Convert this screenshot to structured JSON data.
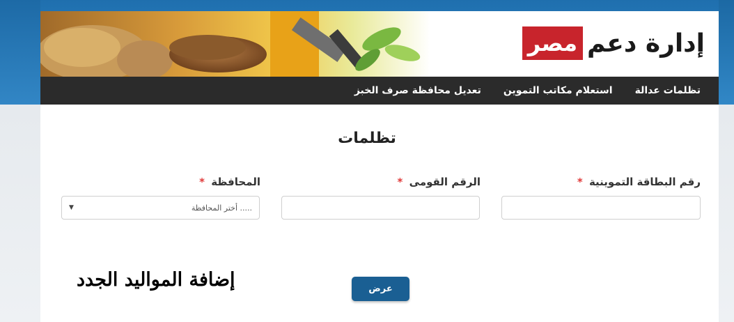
{
  "header": {
    "logo_text": "إدارة دعم",
    "logo_badge": "مصر"
  },
  "nav": {
    "items": [
      {
        "label": "تظلمات عدالة"
      },
      {
        "label": "استعلام مكاتب التموين"
      },
      {
        "label": "تعديل محافظة صرف الخبز"
      }
    ]
  },
  "form": {
    "title": "تظلمات",
    "card_label": "رقم البطاقة التموينية",
    "national_id_label": "الرقم القومى",
    "governorate_label": "المحافظة",
    "required_mark": "*",
    "governorate_placeholder": "..... أختر المحافظة",
    "submit_label": "عرض"
  },
  "overlay_text": "إضافة المواليد الجدد",
  "colors": {
    "navbar": "#2b2b2b",
    "button": "#1a5f93",
    "logo_badge": "#c8242c",
    "required": "#e03a3a"
  }
}
